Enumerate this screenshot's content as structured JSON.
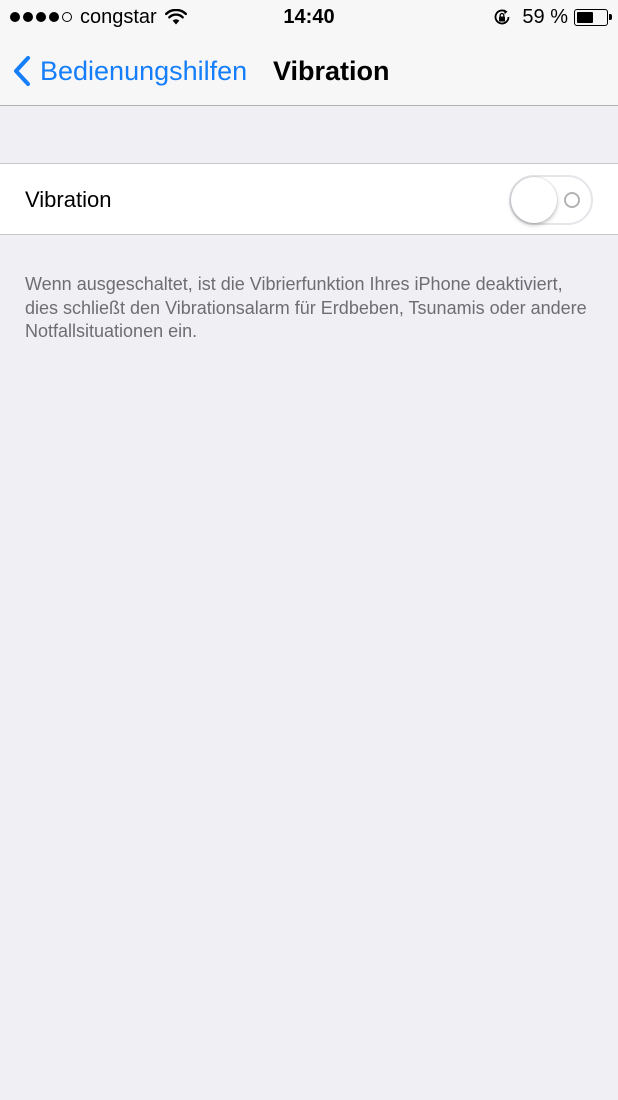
{
  "status_bar": {
    "carrier": "congstar",
    "time": "14:40",
    "battery_text": "59 %",
    "battery_level": 0.59,
    "signal_bars_filled": 4,
    "signal_bars_total": 5,
    "icons": [
      "signal-dots-icon",
      "wifi-icon",
      "orientation-lock-icon",
      "battery-icon"
    ]
  },
  "nav": {
    "back_label": "Bedienungshilfen",
    "title": "Vibration",
    "accent_color": "#157efb"
  },
  "settings": {
    "vibration_label": "Vibration",
    "vibration_enabled": false,
    "footer": "Wenn ausgeschaltet, ist die Vibrierfunktion Ihres iPhone deaktiviert, dies schließt den Vibrationsalarm für Erdbeben, Tsunamis oder andere Notfallsituationen ein."
  }
}
